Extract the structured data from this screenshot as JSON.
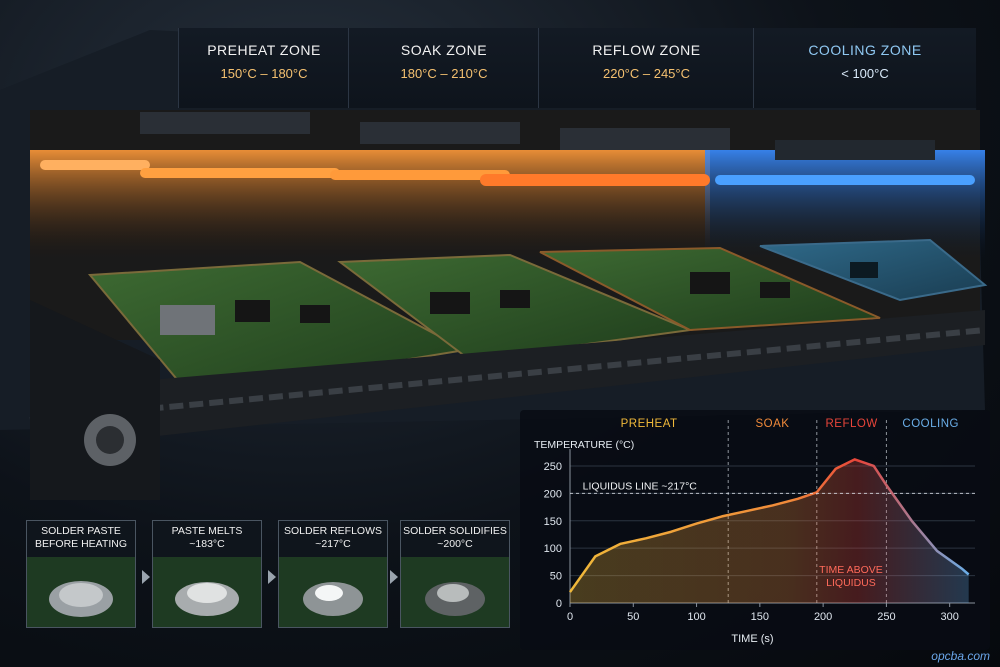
{
  "zones": [
    {
      "name": "PREHEAT ZONE",
      "temp": "150°C – 180°C"
    },
    {
      "name": "SOAK ZONE",
      "temp": "180°C – 210°C"
    },
    {
      "name": "REFLOW ZONE",
      "temp": "220°C – 245°C"
    },
    {
      "name": "COOLING ZONE",
      "temp": "< 100°C"
    }
  ],
  "steps": [
    {
      "label": "SOLDER PASTE\nBEFORE HEATING"
    },
    {
      "label": "PASTE MELTS\n~183°C"
    },
    {
      "label": "SOLDER REFLOWS\n~217°C"
    },
    {
      "label": "SOLDER SOLIDIFIES\n~200°C"
    }
  ],
  "watermark": "opcba.com",
  "colors": {
    "preheat": "#f0b93a",
    "soak": "#f08a3a",
    "reflow": "#e8453a",
    "cooling": "#6aaee8"
  },
  "chart_data": {
    "type": "area",
    "xlabel": "TIME (s)",
    "ylabel": "TEMPERATURE (°C)",
    "xlim": [
      0,
      320
    ],
    "ylim": [
      0,
      270
    ],
    "xticks": [
      0,
      50,
      100,
      150,
      200,
      250,
      300
    ],
    "yticks": [
      0,
      50,
      100,
      150,
      200,
      250
    ],
    "phases": [
      {
        "name": "PREHEAT",
        "start": 0,
        "end": 125
      },
      {
        "name": "SOAK",
        "start": 125,
        "end": 195
      },
      {
        "name": "REFLOW",
        "start": 195,
        "end": 250
      },
      {
        "name": "COOLING",
        "start": 250,
        "end": 320
      }
    ],
    "liquidus": {
      "value": 200,
      "label": "LIQUIDUS LINE ~217°C"
    },
    "annotation": "TIME ABOVE\nLIQUIDUS",
    "x": [
      0,
      20,
      40,
      60,
      80,
      100,
      120,
      140,
      160,
      180,
      195,
      210,
      225,
      240,
      250,
      270,
      290,
      310,
      315
    ],
    "y": [
      20,
      85,
      108,
      118,
      130,
      145,
      158,
      168,
      178,
      190,
      202,
      245,
      262,
      250,
      215,
      150,
      95,
      62,
      52
    ]
  }
}
